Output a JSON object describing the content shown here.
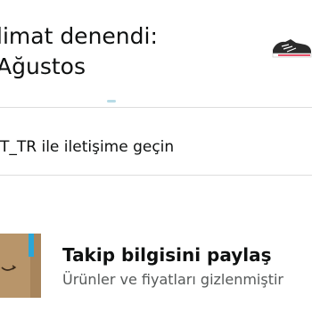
{
  "status": {
    "line1": "limat denendi:",
    "line2": "Ağustos"
  },
  "contact": {
    "label": "T_TR ile iletişime geçin"
  },
  "share_tracking": {
    "title": "Takip bilgisini paylaş",
    "subtitle": "Ürünler ve fiyatları gizlenmiştir"
  },
  "icons": {
    "product_thumbnail": "running-shoe-thumbnail",
    "package": "cardboard-box-icon"
  },
  "colors": {
    "text_primary": "#0f1111",
    "text_secondary": "#565959",
    "divider": "#dddddd",
    "box_brown": "#b8956a",
    "box_tape_blue": "#2aa6d8",
    "progress_teal": "#b7dbe6"
  }
}
